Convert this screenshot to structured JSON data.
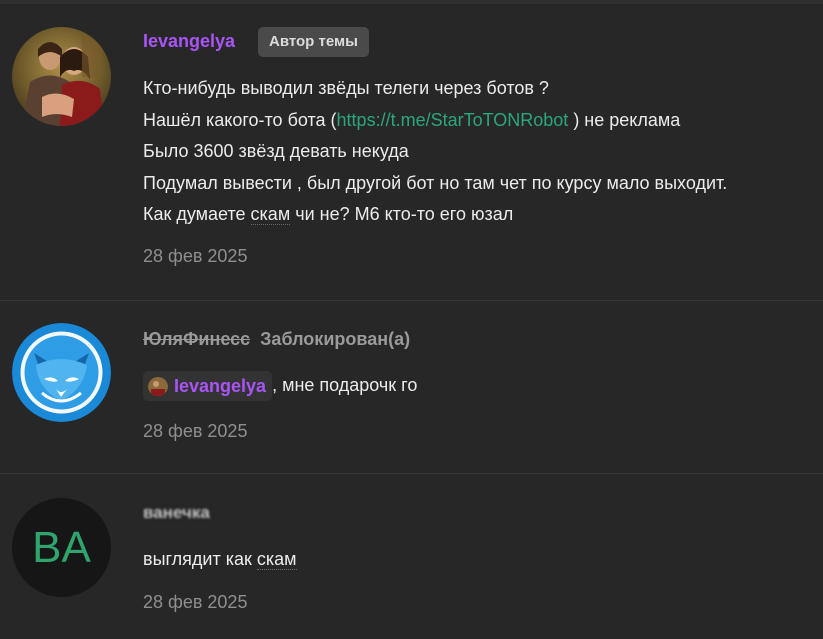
{
  "posts": [
    {
      "username": "Ievangelya",
      "badge": "Автор темы",
      "lines": [
        "Кто-нибудь выводил звёды телеги через ботов ?",
        "Нашёл какого-то бота (",
        "https://t.me/StarToTONRobot",
        " ) не реклама",
        "Было 3600 звёзд девать некуда",
        "Подумал вывести , был другой бот но там чет по курсу мало выходит.",
        "Как думаете ",
        "скам",
        " чи не? М6 кто-то его юзал"
      ],
      "date": "28 фев 2025"
    },
    {
      "username": "ЮляФинесс",
      "status": "Заблокирован(а)",
      "mention": "Ievangelya",
      "text": ", мне подарочк го",
      "date": "28 фев 2025"
    },
    {
      "username": "ванечка",
      "avatar_initials": "BA",
      "text_before": "выглядит как ",
      "text_dotted": "скам",
      "date": "28 фев 2025"
    }
  ],
  "colors": {
    "background": "#272727",
    "username": "#a855f7",
    "link": "#2aa87a",
    "initials": "#2fa46c",
    "fox_blue": "#1e88d6"
  },
  "icons": [
    "photo-avatar",
    "fox-avatar-icon",
    "initials-avatar"
  ]
}
